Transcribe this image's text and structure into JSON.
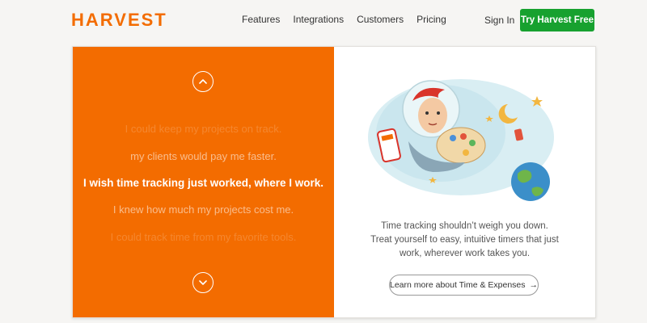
{
  "brand": {
    "logo": "HARVEST"
  },
  "nav": {
    "links": [
      "Features",
      "Integrations",
      "Customers",
      "Pricing"
    ],
    "signin": "Sign In",
    "cta": "Try Harvest Free"
  },
  "hero": {
    "phrases": [
      "I could keep my projects on track.",
      "my clients would pay me faster.",
      "I wish time tracking just worked, where I work.",
      "I knew how much my projects cost me.",
      "I could track time from my favorite tools."
    ],
    "icons": {
      "prev": "chevron-up-icon",
      "next": "chevron-down-icon"
    }
  },
  "promo": {
    "lines": [
      "Time tracking shouldn’t weigh you down.",
      "Treat yourself to easy, intuitive timers that just",
      "work, wherever work takes you."
    ],
    "link_label": "Learn more about Time & Expenses",
    "link_arrow": "→"
  },
  "colors": {
    "brand": "#f36c00",
    "cta": "#17a12f"
  }
}
